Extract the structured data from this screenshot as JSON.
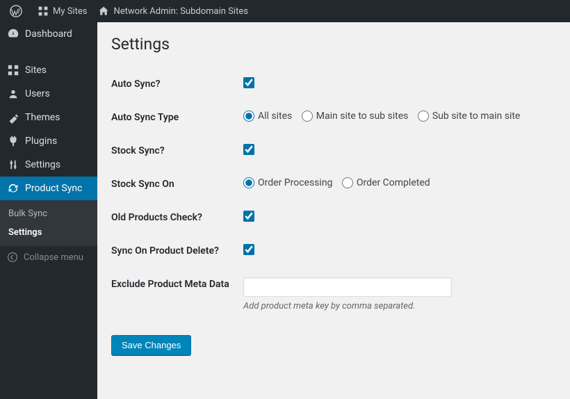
{
  "adminbar": {
    "mysites": "My Sites",
    "network": "Network Admin: Subdomain Sites"
  },
  "sidebar": {
    "items": [
      {
        "label": "Dashboard"
      },
      {
        "label": "Sites"
      },
      {
        "label": "Users"
      },
      {
        "label": "Themes"
      },
      {
        "label": "Plugins"
      },
      {
        "label": "Settings"
      },
      {
        "label": "Product Sync"
      }
    ],
    "submenu": [
      {
        "label": "Bulk Sync"
      },
      {
        "label": "Settings"
      }
    ],
    "collapse": "Collapse menu"
  },
  "page": {
    "heading": "Settings",
    "fields": {
      "auto_sync_label": "Auto Sync?",
      "auto_sync_type_label": "Auto Sync Type",
      "auto_sync_type_options": {
        "all": "All sites",
        "main_to_sub": "Main site to sub sites",
        "sub_to_main": "Sub site to main site"
      },
      "stock_sync_label": "Stock Sync?",
      "stock_sync_on_label": "Stock Sync On",
      "stock_sync_on_options": {
        "processing": "Order Processing",
        "completed": "Order Completed"
      },
      "old_products_label": "Old Products Check?",
      "sync_on_delete_label": "Sync On Product Delete?",
      "exclude_meta_label": "Exclude Product Meta Data",
      "exclude_meta_value": "",
      "exclude_meta_desc": "Add product meta key by comma separated."
    },
    "submit": "Save Changes"
  }
}
